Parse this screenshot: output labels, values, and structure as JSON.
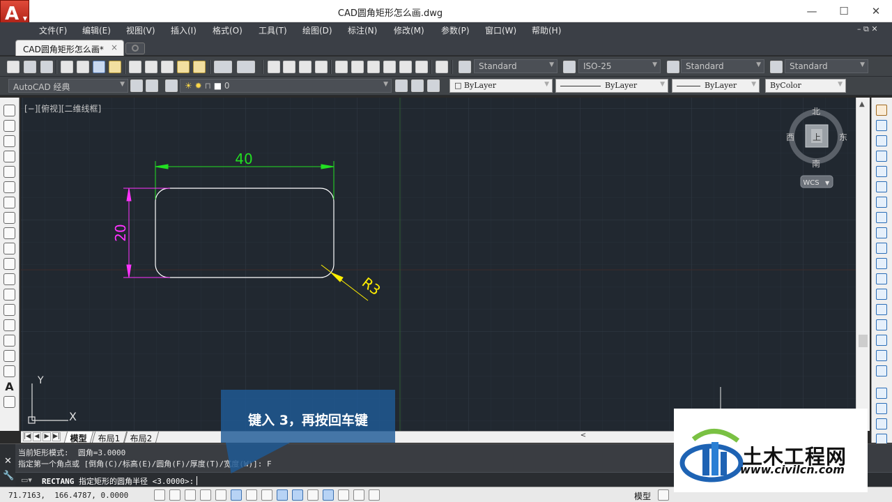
{
  "window": {
    "title": "CAD圆角矩形怎么画.dwg",
    "app_icon_letter": "A",
    "minimize": "—",
    "maximize": "☐",
    "close": "✕"
  },
  "menu": {
    "items": [
      "文件(F)",
      "编辑(E)",
      "视图(V)",
      "插入(I)",
      "格式(O)",
      "工具(T)",
      "绘图(D)",
      "标注(N)",
      "修改(M)",
      "参数(P)",
      "窗口(W)",
      "帮助(H)"
    ],
    "mdi_controls": "– ⧉ ✕"
  },
  "tabs": {
    "document": "CAD圆角矩形怎么画*",
    "close_glyph": "×"
  },
  "toolbar": {
    "text_style": "Standard",
    "dim_style": "ISO-25",
    "table_style": "Standard",
    "mleader_style": "Standard",
    "workspace": "AutoCAD 经典",
    "layer": "0",
    "color": "ByLayer",
    "linetype": "ByLayer",
    "lineweight": "ByLayer",
    "plot_style": "ByColor"
  },
  "viewport": {
    "label": "[−][俯视][二维线框]",
    "viewcube": {
      "north": "北",
      "south": "南",
      "east": "东",
      "west": "西",
      "face": "上",
      "wcs": "WCS"
    },
    "ucs": {
      "y": "Y",
      "x": "X"
    }
  },
  "drawing": {
    "dim_width": "40",
    "dim_height": "20",
    "dim_radius": "R3",
    "colors": {
      "geometry": "#ffffff",
      "dim_width": "#22e022",
      "dim_height": "#ff33ff",
      "dim_radius": "#ffee00"
    }
  },
  "layout_tabs": [
    "模型",
    "布局1",
    "布局2"
  ],
  "command": {
    "history": [
      "当前矩形模式:  圆角=3.0000",
      "指定第一个角点或 [倒角(C)/标高(E)/圆角(F)/厚度(T)/宽度(W)]: F"
    ],
    "prompt_command": "RECTANG",
    "prompt_text": "指定矩形的圆角半径 <3.0000>:"
  },
  "status": {
    "coordinates": "71.7163,  166.4787, 0.0000",
    "space": "模型"
  },
  "callout": {
    "text": "键入 3，再按回车键"
  },
  "watermark": {
    "title": "土木工程网",
    "url": "www.civilcn.com"
  }
}
